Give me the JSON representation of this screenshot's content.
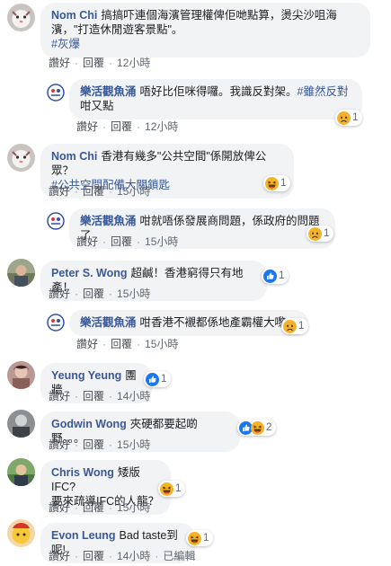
{
  "actions": {
    "like": "讚好",
    "reply": "回覆",
    "edited": "已編輯",
    "sep": "·"
  },
  "comments": [
    {
      "author": "Nom Chi",
      "lines": [
        "搞搞吓連個海濱管理權俾佢哋點算，燙尖沙咀海",
        "濱，\"打造休閒遊客景點\"。"
      ],
      "hashtag": "#灰爆",
      "time": "12小時"
    },
    {
      "author": "樂活觀魚涌",
      "lines": [
        "唔好比佢咪得囉。我識反對架。",
        "咁又點"
      ],
      "hashtag": "#雖然反對",
      "time": "12小時",
      "reaction_count": "1"
    },
    {
      "author": "Nom Chi",
      "lines": [
        "香港有幾多\"公共空間\"係開放俾公眾？"
      ],
      "hashtag": "#公共空間配備大關鎖匙",
      "time": "15小時",
      "reaction_count": "1"
    },
    {
      "author": "樂活觀魚涌",
      "lines": [
        "咁就唔係發展商問題，係政府的問題了"
      ],
      "time": "15小時",
      "reaction_count": "1"
    },
    {
      "author": "Peter S. Wong",
      "lines": [
        "超鹹！香港窮得只有地產！"
      ],
      "time": "15小時",
      "reaction_count": "1"
    },
    {
      "author": "樂活觀魚涌",
      "lines": [
        "咁香港不襯都係地產霸權大嚟"
      ],
      "time": "15小時",
      "reaction_count": "1"
    },
    {
      "author": "Yeung Yeung",
      "lines": [
        "團牆"
      ],
      "time": "14小時",
      "reaction_count": "1"
    },
    {
      "author": "Godwin Wong",
      "lines": [
        "夾硬都要起啲野。。。"
      ],
      "time": "15小時",
      "reaction_count": "2"
    },
    {
      "author": "Chris Wong",
      "lines": [
        "矮版IFC?",
        "要來疏導IFC的人龍？"
      ],
      "time": "15小時",
      "reaction_count": "1"
    },
    {
      "author": "Evon Leung",
      "lines": [
        "Bad taste到呢!"
      ],
      "time": "14小時",
      "reaction_count": "1"
    }
  ],
  "icons": {
    "like": "like-icon",
    "haha": "haha-icon",
    "sad": "sad-icon"
  },
  "colors": {
    "name": "#385898",
    "bubble": "#f2f3f5",
    "like": "#1877f2",
    "emoji": "#f7b125"
  }
}
